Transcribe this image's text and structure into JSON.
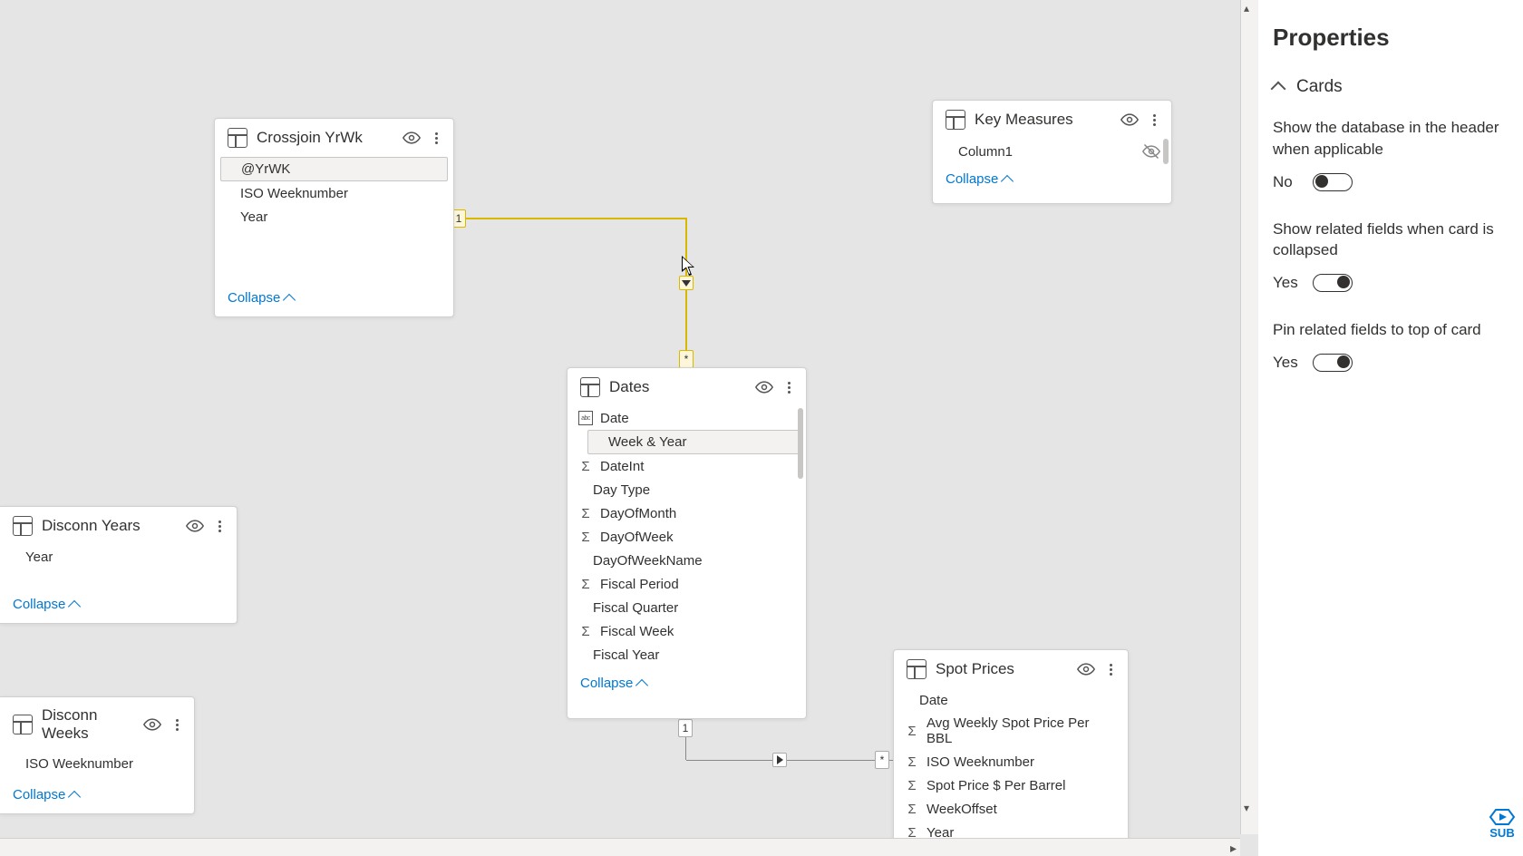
{
  "tables": {
    "crossjoin": {
      "title": "Crossjoin YrWk",
      "fields": [
        "@YrWK",
        "ISO Weeknumber",
        "Year"
      ],
      "collapse": "Collapse"
    },
    "keymeasures": {
      "title": "Key Measures",
      "fields": [
        "Column1"
      ],
      "collapse": "Collapse"
    },
    "disconnYears": {
      "title": "Disconn Years",
      "fields": [
        "Year"
      ],
      "collapse": "Collapse"
    },
    "disconnWeeks": {
      "title": "Disconn Weeks",
      "fields": [
        "ISO Weeknumber"
      ],
      "collapse": "Collapse"
    },
    "dates": {
      "title": "Dates",
      "fields": [
        {
          "label": "Date",
          "icon": "type"
        },
        {
          "label": "Week & Year",
          "icon": null,
          "selected": true
        },
        {
          "label": "DateInt",
          "icon": "sigma"
        },
        {
          "label": "Day Type",
          "icon": null
        },
        {
          "label": "DayOfMonth",
          "icon": "sigma"
        },
        {
          "label": "DayOfWeek",
          "icon": "sigma"
        },
        {
          "label": "DayOfWeekName",
          "icon": null
        },
        {
          "label": "Fiscal Period",
          "icon": "sigma"
        },
        {
          "label": "Fiscal Quarter",
          "icon": null
        },
        {
          "label": "Fiscal Week",
          "icon": "sigma"
        },
        {
          "label": "Fiscal Year",
          "icon": null
        }
      ],
      "collapse": "Collapse"
    },
    "spot": {
      "title": "Spot Prices",
      "fields": [
        {
          "label": "Date",
          "icon": null
        },
        {
          "label": "Avg Weekly Spot Price Per BBL",
          "icon": "sigma"
        },
        {
          "label": "ISO Weeknumber",
          "icon": "sigma"
        },
        {
          "label": "Spot Price $ Per Barrel",
          "icon": "sigma"
        },
        {
          "label": "WeekOffset",
          "icon": "sigma"
        },
        {
          "label": "Year",
          "icon": "sigma"
        }
      ],
      "collapse": "Collapse"
    }
  },
  "relationships": {
    "r1": {
      "from": "1",
      "to": "*"
    },
    "r2": {
      "from": "1",
      "to": "*"
    }
  },
  "properties": {
    "title": "Properties",
    "section": "Cards",
    "rows": [
      {
        "label": "Show the database in the header when applicable",
        "value": "No",
        "on": false
      },
      {
        "label": "Show related fields when card is collapsed",
        "value": "Yes",
        "on": true
      },
      {
        "label": "Pin related fields to top of card",
        "value": "Yes",
        "on": true
      }
    ]
  },
  "sub_badge": "SUB"
}
